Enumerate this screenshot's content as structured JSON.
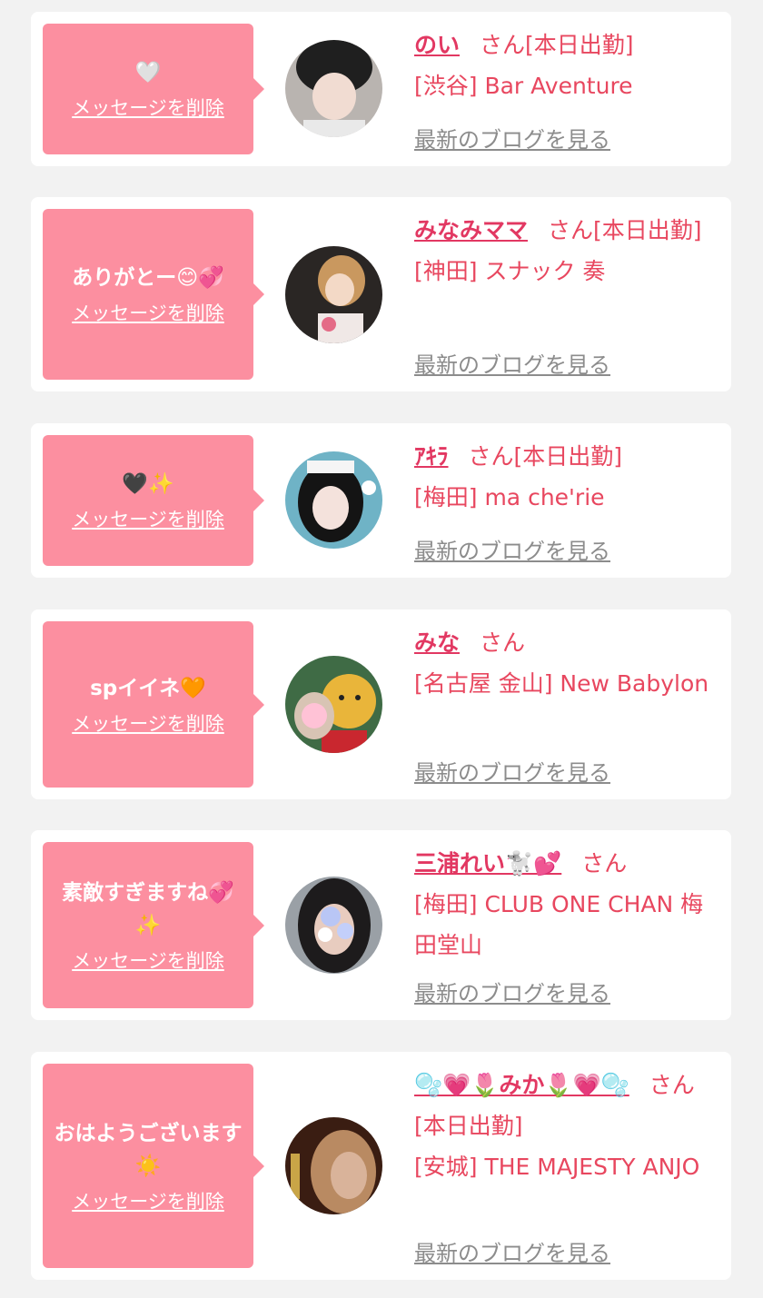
{
  "delete_label": "メッセージを削除",
  "blog_label": "最新のブログを見る",
  "san_label": "さん",
  "entries": [
    {
      "message": "🤍",
      "name": "のい",
      "status": "[本日出勤]",
      "store": "[渋谷] Bar Aventure"
    },
    {
      "message": "ありがとー😊💞",
      "name": "みなみママ",
      "status": "[本日出勤]",
      "store": "[神田] スナック 奏"
    },
    {
      "message": "🖤✨",
      "name": "ｱｷﾗ",
      "status": "[本日出勤]",
      "store": "[梅田] ma che'rie"
    },
    {
      "message": "spイイネ🧡",
      "name": "みな",
      "status": "",
      "store": "[名古屋 金山] New Babylon"
    },
    {
      "message": "素敵すぎますね💞✨",
      "name": "三浦れい🐩💕",
      "status": "",
      "store": "[梅田] CLUB ONE CHAN 梅田堂山"
    },
    {
      "message": "おはようございます☀️",
      "name": "🫧💗🌷みか🌷💗🫧",
      "status": "[本日出勤]",
      "store": "[安城] THE MAJESTY ANJO"
    }
  ],
  "colors": {
    "page_bg": "#f2f2f2",
    "card_bg": "#ffffff",
    "bubble_bg": "#fc8fa0",
    "accent_text": "#e8475f",
    "blog_link": "#8c8c8c"
  }
}
